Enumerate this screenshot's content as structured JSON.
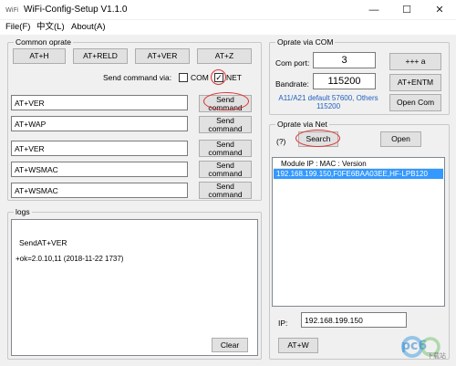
{
  "window": {
    "title": "WiFi-Config-Setup V1.1.0",
    "minimize": "—",
    "maximize": "☐",
    "close": "✕"
  },
  "menu": {
    "items": [
      "File(F)",
      "中文(L)",
      "About(A)"
    ]
  },
  "common": {
    "title": "Common oprate",
    "buttons": [
      "AT+H",
      "AT+RELD",
      "AT+VER",
      "AT+Z"
    ],
    "send_via_label": "Send command via:",
    "com_label": "COM",
    "net_label": "NET",
    "com_checked": false,
    "net_checked": true,
    "commands": [
      {
        "value": "AT+VER",
        "send_label_1": "Send",
        "send_label_2": "command"
      },
      {
        "value": "AT+WAP",
        "send_label_1": "Send",
        "send_label_2": "command"
      },
      {
        "value": "AT+VER",
        "send_label_1": "Send",
        "send_label_2": "command"
      },
      {
        "value": "AT+WSMAC",
        "send_label_1": "Send",
        "send_label_2": "command"
      },
      {
        "value": "AT+WSMAC",
        "send_label_1": "Send",
        "send_label_2": "command"
      }
    ]
  },
  "logs": {
    "title": "logs",
    "lines": [
      "SendAT+VER",
      "+ok=2.0.10,11 (2018-11-22 1737)"
    ],
    "clear_label": "Clear"
  },
  "com": {
    "title": "Oprate via COM",
    "port_label": "Com port:",
    "port_value": "3",
    "baud_label": "Bandrate:",
    "baud_value": "115200",
    "note": "A11/A21 default 57600, Others 115200",
    "plus_label": "+++ a",
    "entm_label": "AT+ENTM",
    "open_label": "Open Com"
  },
  "net": {
    "title": "Oprate via Net",
    "help_label": "(?)",
    "search_label": "Search",
    "open_label": "Open",
    "list_header": "Module IP  :  MAC  :  Version",
    "list_rows": [
      "192.168.199.150,F0FE6BAA03EE,HF-LPB120"
    ],
    "ip_label": "IP:",
    "ip_value": "192.168.199.150",
    "atw_label": "AT+W"
  },
  "watermark": {
    "text": "pc6",
    "sub": "下载站"
  }
}
